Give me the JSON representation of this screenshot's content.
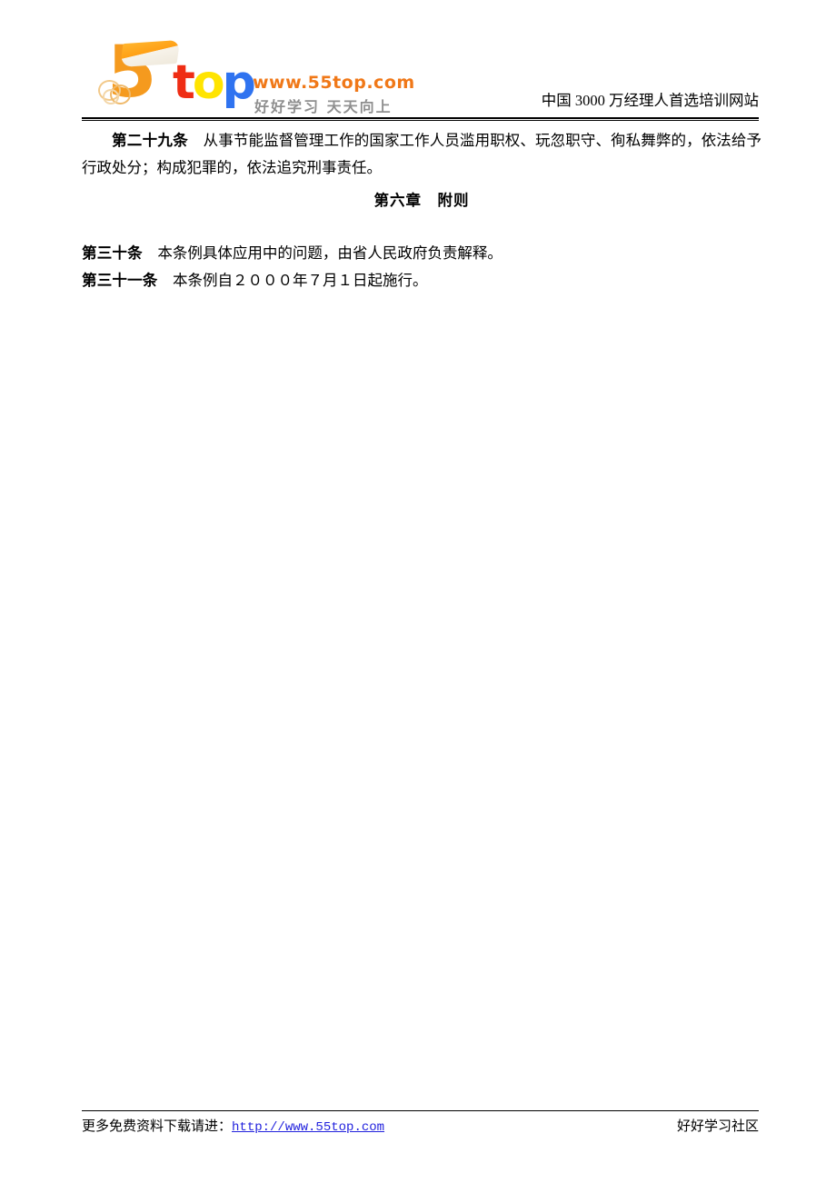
{
  "header": {
    "logo": {
      "mark_digit": "5",
      "word_t": "t",
      "word_o": "o",
      "word_p": "p",
      "url": "www.55top.com",
      "slogan": "好好学习  天天向上",
      "colors": {
        "five": "#f59a1e",
        "t": "#ef2d14",
        "o": "#ffe400",
        "p": "#2f73f0",
        "url": "#f07818",
        "slogan": "#8f8f8f"
      }
    },
    "tagline_right": "中国 3000 万经理人首选培训网站"
  },
  "body": {
    "paragraphs": [
      {
        "label": "第二十九条",
        "text": "　从事节能监督管理工作的国家工作人员滥用职权、玩忽职守、徇私舞弊的，依法给予行政处分；构成犯罪的，依法追究刑事责任。"
      }
    ],
    "chapter_heading": "第六章　附则",
    "articles": [
      {
        "label": "第三十条",
        "text": "　本条例具体应用中的问题，由省人民政府负责解释。"
      },
      {
        "label": "第三十一条",
        "text": "　本条例自２０００年７月１日起施行。"
      }
    ]
  },
  "footer": {
    "left_prefix": "更多免费资料下载请进：",
    "link_text": "http://www.55top.com",
    "link_color": "#2222dd",
    "right_text": "好好学习社区"
  }
}
